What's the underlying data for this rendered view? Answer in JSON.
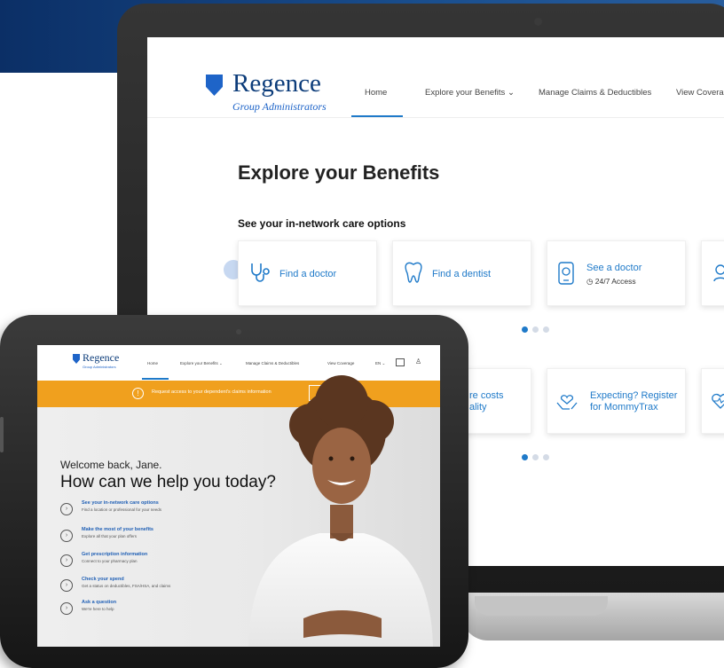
{
  "colors": {
    "brand_blue": "#0c3c7a",
    "link_blue": "#1f7ac9",
    "banner_orange": "#f0a01e"
  },
  "laptop": {
    "logo": {
      "name": "Regence",
      "sub": "Group Administrators"
    },
    "nav": {
      "home": "Home",
      "explore": "Explore your Benefits",
      "claims": "Manage Claims & Deductibles",
      "coverage": "View Coverag"
    },
    "title": "Explore your Benefits",
    "subtitle": "See your in-network care options",
    "cards_row1": [
      {
        "label": "Find a doctor",
        "icon": "stethoscope-icon"
      },
      {
        "label": "Find a dentist",
        "icon": "tooth-icon"
      },
      {
        "label": "See a doctor",
        "sub": "24/7 Access",
        "icon": "phone-doctor-icon"
      }
    ],
    "cards_row2": [
      {
        "label_line1": "re costs",
        "label_line2": "ality"
      },
      {
        "label_line1": "Expecting? Register",
        "label_line2": "for MommyTrax",
        "icon": "hands-heart-icon"
      }
    ]
  },
  "tablet": {
    "logo": {
      "name": "Regence",
      "sub": "Group Administrators"
    },
    "nav": {
      "home": "Home",
      "explore": "Explore your Benefits",
      "claims": "Manage Claims & Deductibles",
      "coverage": "View Coverage",
      "lang": "EN"
    },
    "banner": {
      "text": "Request access to your dependent's claims information",
      "button": "Learn More"
    },
    "welcome": "Welcome back, Jane.",
    "headline": "How can we help you today?",
    "options": [
      {
        "title": "See your in-network care options",
        "sub": "Find a location or professional for your needs"
      },
      {
        "title": "Make the most of your benefits",
        "sub": "Explore all that your plan offers"
      },
      {
        "title": "Get prescription information",
        "sub": "Connect to your pharmacy plan"
      },
      {
        "title": "Check your spend",
        "sub": "Get a status on deductibles, FSA/HSA, and claims"
      },
      {
        "title": "Ask a question",
        "sub": "We're here to help"
      }
    ]
  }
}
